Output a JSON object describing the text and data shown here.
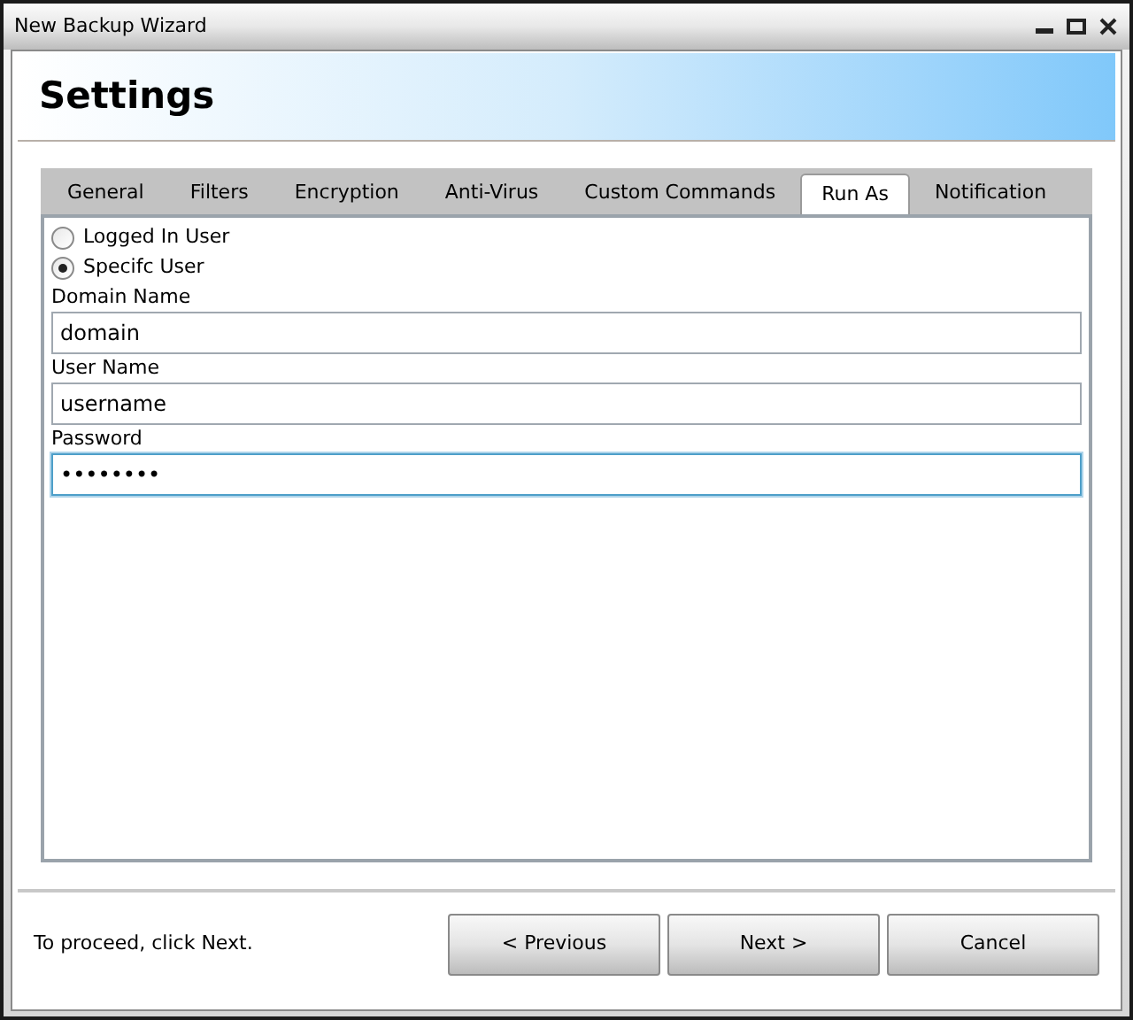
{
  "window": {
    "title": "New Backup Wizard"
  },
  "header": {
    "title": "Settings"
  },
  "tabs": [
    {
      "label": "General",
      "selected": false
    },
    {
      "label": "Filters",
      "selected": false
    },
    {
      "label": "Encryption",
      "selected": false
    },
    {
      "label": "Anti-Virus",
      "selected": false
    },
    {
      "label": "Custom Commands",
      "selected": false
    },
    {
      "label": "Run As",
      "selected": true
    },
    {
      "label": "Notification",
      "selected": false
    }
  ],
  "run_as": [
    {
      "label": "Logged In User",
      "selected": false
    },
    {
      "label": "Specifc User",
      "selected": true
    }
  ],
  "fields": [
    {
      "label": "Domain Name",
      "value": "domain",
      "focused": false
    },
    {
      "label": "User Name",
      "value": "username",
      "focused": false
    },
    {
      "label": "Password",
      "value": "••••••••",
      "focused": true
    }
  ],
  "footer": {
    "hint": "To proceed, click Next.",
    "buttons": [
      "< Previous",
      "Next >",
      "Cancel"
    ]
  }
}
